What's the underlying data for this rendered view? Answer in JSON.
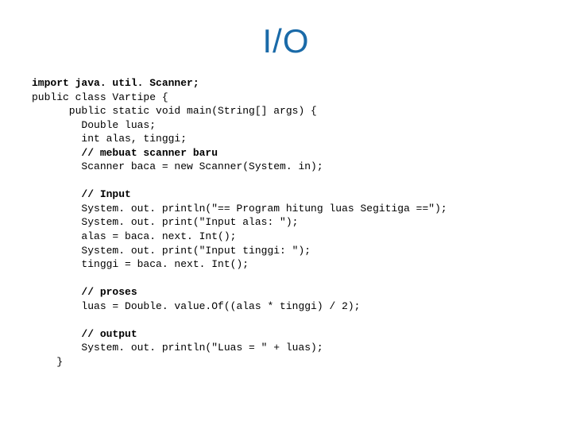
{
  "title": "I/O",
  "code": {
    "l01a": "import",
    "l01b": " java. util. Scanner;",
    "l02": "public class Vartipe {",
    "l03": "      public static void main(String[] args) {",
    "l04": "        Double luas;",
    "l05": "        int alas, tinggi;",
    "l06": "        // mebuat scanner baru",
    "l07": "        Scanner baca = new Scanner(System. in);",
    "blank1": "",
    "l08": "        // Input",
    "l09": "        System. out. println(\"== Program hitung luas Segitiga ==\");",
    "l10": "        System. out. print(\"Input alas: \");",
    "l11": "        alas = baca. next. Int();",
    "l12": "        System. out. print(\"Input tinggi: \");",
    "l13": "        tinggi = baca. next. Int();",
    "blank2": "",
    "l14": "        // proses",
    "l15": "        luas = Double. value.Of((alas * tinggi) / 2);",
    "blank3": "",
    "l16": "        // output",
    "l17": "        System. out. println(\"Luas = \" + luas);",
    "l18": "    }"
  }
}
